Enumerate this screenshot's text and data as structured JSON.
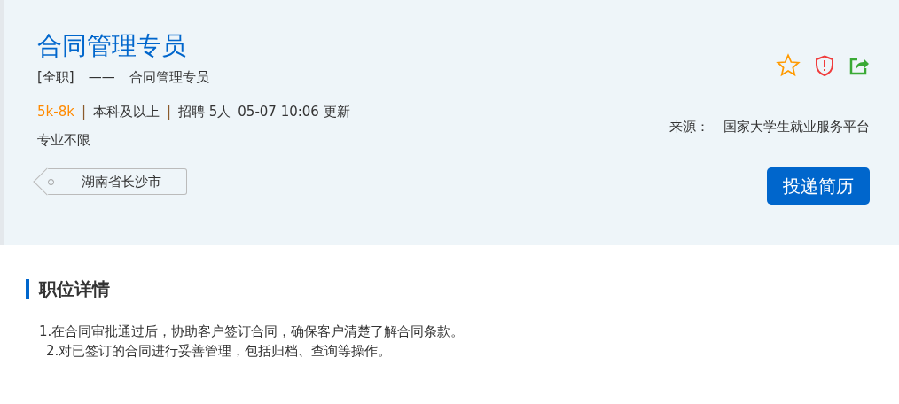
{
  "job": {
    "title": "合同管理专员",
    "type": "[全职]",
    "dash": "——",
    "subtitle": "合同管理专员",
    "salary": "5k-8k",
    "separator_1": "|",
    "education": "本科及以上",
    "separator_2": "|",
    "headcount": "招聘 5人",
    "updated": "05-07 10:06 更新",
    "major": "专业不限",
    "location": "湖南省长沙市",
    "favorited": false,
    "source_label": "来源：",
    "source": "国家大学生就业服务平台",
    "apply_button": "投递简历"
  },
  "details": {
    "heading": "职位详情",
    "lines": [
      "1.在合同审批通过后，协助客户签订合同，确保客户清楚了解合同条款。",
      "2.对已签订的合同进行妥善管理，包括归档、查询等操作。"
    ]
  }
}
